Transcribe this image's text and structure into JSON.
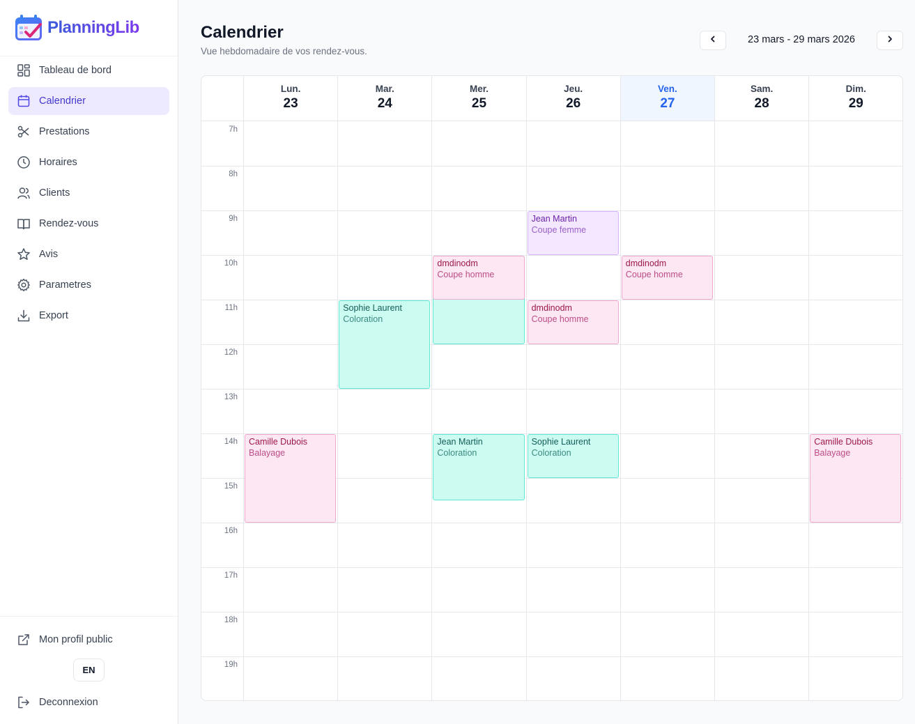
{
  "app": {
    "name": "PlanningLib"
  },
  "sidebar": {
    "items": [
      {
        "label": "Tableau de bord",
        "icon": "dashboard-icon"
      },
      {
        "label": "Calendrier",
        "icon": "calendar-icon",
        "active": true
      },
      {
        "label": "Prestations",
        "icon": "scissors-icon"
      },
      {
        "label": "Horaires",
        "icon": "clock-icon"
      },
      {
        "label": "Clients",
        "icon": "users-icon"
      },
      {
        "label": "Rendez-vous",
        "icon": "book-icon"
      },
      {
        "label": "Avis",
        "icon": "star-icon"
      },
      {
        "label": "Parametres",
        "icon": "gear-icon"
      },
      {
        "label": "Export",
        "icon": "download-icon"
      }
    ],
    "bottom": {
      "profile_label": "Mon profil public",
      "lang_label": "EN",
      "logout_label": "Deconnexion"
    }
  },
  "header": {
    "title": "Calendrier",
    "subtitle": "Vue hebdomadaire de vos rendez-vous.",
    "week_range": "23 mars - 29 mars 2026"
  },
  "calendar": {
    "days": [
      {
        "name": "Lun.",
        "num": "23"
      },
      {
        "name": "Mar.",
        "num": "24"
      },
      {
        "name": "Mer.",
        "num": "25"
      },
      {
        "name": "Jeu.",
        "num": "26"
      },
      {
        "name": "Ven.",
        "num": "27",
        "today": true
      },
      {
        "name": "Sam.",
        "num": "28"
      },
      {
        "name": "Dim.",
        "num": "29"
      }
    ],
    "hours": [
      "7h",
      "8h",
      "9h",
      "10h",
      "11h",
      "12h",
      "13h",
      "14h",
      "15h",
      "16h",
      "17h",
      "18h",
      "19h"
    ],
    "events": [
      {
        "day": 3,
        "start": 9,
        "end": 10,
        "name": "Jean Martin",
        "service": "Coupe femme",
        "color": "violet"
      },
      {
        "day": 2,
        "start": 10,
        "end": 12,
        "name": "dmdinodm",
        "service": "Coupe homme",
        "color": "teal-under"
      },
      {
        "day": 2,
        "start": 10,
        "end": 11,
        "name": "dmdinodm",
        "service": "Coupe homme",
        "color": "pink"
      },
      {
        "day": 4,
        "start": 10,
        "end": 11,
        "name": "dmdinodm",
        "service": "Coupe homme",
        "color": "pink"
      },
      {
        "day": 1,
        "start": 11,
        "end": 13,
        "name": "Sophie Laurent",
        "service": "Coloration",
        "color": "teal"
      },
      {
        "day": 3,
        "start": 11,
        "end": 12,
        "name": "dmdinodm",
        "service": "Coupe homme",
        "color": "pink"
      },
      {
        "day": 0,
        "start": 14,
        "end": 16,
        "name": "Camille Dubois",
        "service": "Balayage",
        "color": "pink"
      },
      {
        "day": 2,
        "start": 14,
        "end": 15.5,
        "name": "Jean Martin",
        "service": "Coloration",
        "color": "teal"
      },
      {
        "day": 3,
        "start": 14,
        "end": 15,
        "name": "Sophie Laurent",
        "service": "Coloration",
        "color": "teal"
      },
      {
        "day": 6,
        "start": 14,
        "end": 16,
        "name": "Camille Dubois",
        "service": "Balayage",
        "color": "pink"
      }
    ]
  }
}
